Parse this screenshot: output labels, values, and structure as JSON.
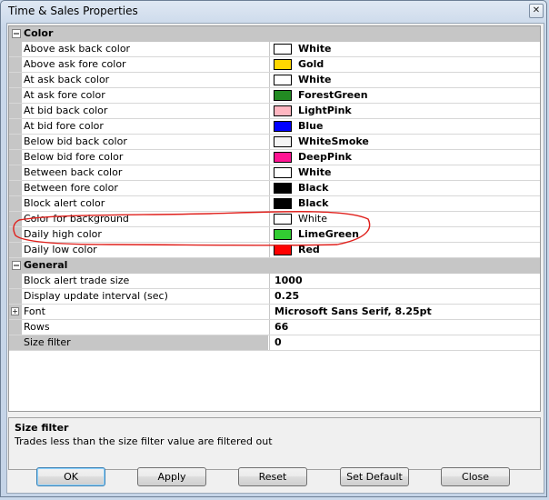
{
  "window": {
    "title": "Time & Sales Properties",
    "close_glyph": "✕"
  },
  "categories": [
    {
      "label": "Color",
      "toggle": "⊟",
      "properties": [
        {
          "name": "Above ask back color",
          "value": "White",
          "color": "#ffffff",
          "bold": true
        },
        {
          "name": "Above ask fore color",
          "value": "Gold",
          "color": "#ffd700",
          "bold": true
        },
        {
          "name": "At ask back color",
          "value": "White",
          "color": "#ffffff",
          "bold": true
        },
        {
          "name": "At ask fore color",
          "value": "ForestGreen",
          "color": "#228b22",
          "bold": true
        },
        {
          "name": "At bid back color",
          "value": "LightPink",
          "color": "#ffb6c1",
          "bold": true
        },
        {
          "name": "At bid fore color",
          "value": "Blue",
          "color": "#0000ff",
          "bold": true
        },
        {
          "name": "Below bid back color",
          "value": "WhiteSmoke",
          "color": "#f5f5f5",
          "bold": true
        },
        {
          "name": "Below bid fore color",
          "value": "DeepPink",
          "color": "#ff1493",
          "bold": true
        },
        {
          "name": "Between back color",
          "value": "White",
          "color": "#ffffff",
          "bold": true
        },
        {
          "name": "Between fore color",
          "value": "Black",
          "color": "#000000",
          "bold": true
        },
        {
          "name": "Block alert color",
          "value": "Black",
          "color": "#000000",
          "bold": true
        },
        {
          "name": "Color for background",
          "value": "White",
          "color": "#ffffff",
          "bold": false
        },
        {
          "name": "Daily high color",
          "value": "LimeGreen",
          "color": "#32cd32",
          "bold": true
        },
        {
          "name": "Daily low color",
          "value": "Red",
          "color": "#ff0000",
          "bold": true
        }
      ]
    },
    {
      "label": "General",
      "toggle": "⊟",
      "properties": [
        {
          "name": "Block alert trade size",
          "value": "1000",
          "bold": true
        },
        {
          "name": "Display update interval (sec)",
          "value": "0.25",
          "bold": true
        },
        {
          "name": "Font",
          "value": "Microsoft Sans Serif, 8.25pt",
          "bold": true,
          "expandable": true,
          "expand_glyph": "+"
        },
        {
          "name": "Rows",
          "value": "66",
          "bold": true
        },
        {
          "name": "Size filter",
          "value": "0",
          "bold": true,
          "selected": true
        }
      ]
    }
  ],
  "help": {
    "title": "Size filter",
    "description": "Trades less than the size filter value are filtered out"
  },
  "buttons": {
    "ok": "OK",
    "apply": "Apply",
    "reset": "Reset",
    "set_default": "Set Default",
    "close": "Close"
  },
  "annotation": {
    "color": "#e0201c"
  }
}
